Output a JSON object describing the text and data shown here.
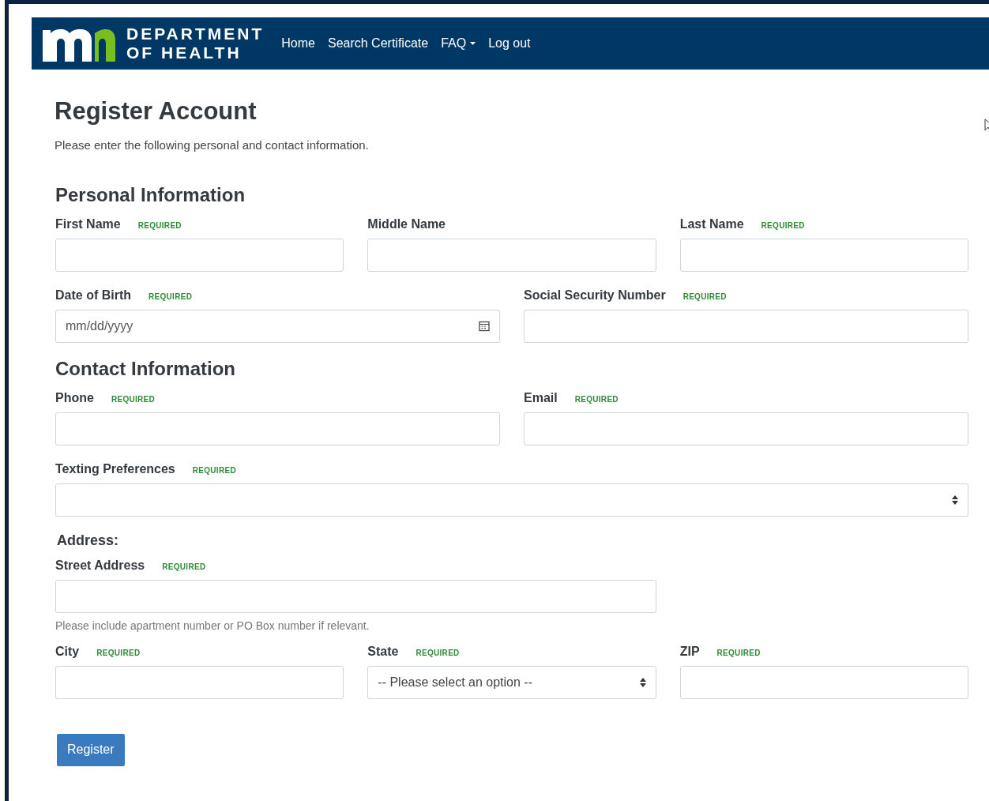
{
  "header": {
    "brand_line_1": "DEPARTMENT",
    "brand_line_2": "OF HEALTH",
    "nav": [
      {
        "label": "Home",
        "dropdown": false
      },
      {
        "label": "Search Certificate",
        "dropdown": false
      },
      {
        "label": "FAQ",
        "dropdown": true
      },
      {
        "label": "Log out",
        "dropdown": false
      }
    ]
  },
  "page": {
    "title": "Register Account",
    "intro": "Please enter the following personal and contact information."
  },
  "form": [
    {
      "kind": "heading",
      "text": "Personal Information"
    },
    {
      "kind": "row",
      "fields": [
        {
          "label": "First Name",
          "badge": "REQUIRED",
          "kind": "text"
        },
        {
          "label": "Middle Name",
          "kind": "text"
        },
        {
          "label": "Last Name",
          "badge": "REQUIRED",
          "kind": "text"
        }
      ]
    },
    {
      "kind": "row",
      "fields": [
        {
          "label": "Date of Birth",
          "badge": "REQUIRED",
          "kind": "date",
          "placeholder": "mm/dd/yyyy"
        },
        {
          "label": "Social Security Number",
          "badge": "REQUIRED",
          "kind": "text"
        }
      ]
    },
    {
      "kind": "heading",
      "text": "Contact Information"
    },
    {
      "kind": "row",
      "fields": [
        {
          "label": "Phone",
          "badge": "REQUIRED",
          "kind": "text"
        },
        {
          "label": "Email",
          "badge": "REQUIRED",
          "kind": "text"
        }
      ]
    },
    {
      "kind": "row",
      "fields": [
        {
          "label": "Texting Preferences",
          "badge": "REQUIRED",
          "kind": "select"
        }
      ]
    },
    {
      "kind": "subheading",
      "text": "Address:"
    },
    {
      "kind": "row",
      "fields": [
        {
          "label": "Street Address",
          "badge": "REQUIRED",
          "kind": "text",
          "help": "Please include apartment number or PO Box number if relevant."
        }
      ]
    },
    {
      "kind": "row",
      "fields": [
        {
          "label": "City",
          "badge": "REQUIRED",
          "kind": "text"
        },
        {
          "label": "State",
          "badge": "REQUIRED",
          "kind": "select",
          "value": "-- Please select an option --"
        },
        {
          "label": "ZIP",
          "badge": "REQUIRED",
          "kind": "text"
        }
      ]
    }
  ],
  "submit": "Register"
}
